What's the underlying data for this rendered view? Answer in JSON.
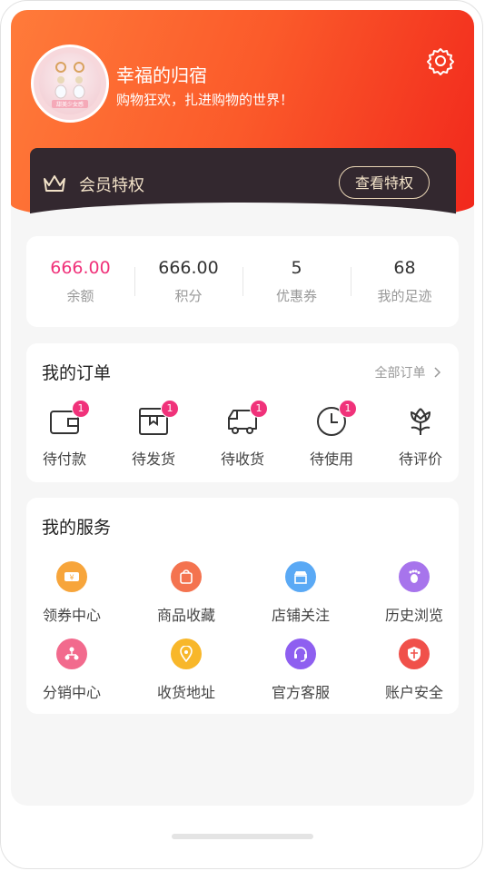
{
  "profile": {
    "username": "幸福的归宿",
    "signature": "购物狂欢，扎进购物的世界！",
    "avatar_text": "甜美少女感"
  },
  "vip": {
    "title": "会员特权",
    "button": "查看特权"
  },
  "stats": [
    {
      "value": "666.00",
      "label": "余额"
    },
    {
      "value": "666.00",
      "label": "积分"
    },
    {
      "value": "5",
      "label": "优惠券"
    },
    {
      "value": "68",
      "label": "我的足迹"
    }
  ],
  "orders": {
    "title": "我的订单",
    "all_link": "全部订单",
    "items": [
      {
        "label": "待付款",
        "badge": "1",
        "icon": "wallet-icon"
      },
      {
        "label": "待发货",
        "badge": "1",
        "icon": "box-icon"
      },
      {
        "label": "待收货",
        "badge": "1",
        "icon": "truck-icon"
      },
      {
        "label": "待使用",
        "badge": "1",
        "icon": "clock-icon"
      },
      {
        "label": "待评价",
        "badge": "",
        "icon": "flower-icon"
      }
    ]
  },
  "services": {
    "title": "我的服务",
    "items": [
      {
        "label": "领券中心",
        "icon": "coupon-icon",
        "color": "#f7a53b"
      },
      {
        "label": "商品收藏",
        "icon": "bag-icon",
        "color": "#f4734f"
      },
      {
        "label": "店铺关注",
        "icon": "store-icon",
        "color": "#5aa9f5"
      },
      {
        "label": "历史浏览",
        "icon": "footprint-icon",
        "color": "#a774ec"
      },
      {
        "label": "分销中心",
        "icon": "distribution-icon",
        "color": "#f26a8d"
      },
      {
        "label": "收货地址",
        "icon": "location-icon",
        "color": "#f8b72a"
      },
      {
        "label": "官方客服",
        "icon": "headset-icon",
        "color": "#8e5ff0"
      },
      {
        "label": "账户安全",
        "icon": "shield-icon",
        "color": "#f0504a"
      }
    ]
  },
  "colors": {
    "header_start": "#ff7b3a",
    "header_end": "#f1271c",
    "vip_bg": "#33282f",
    "vip_text": "#f2e2c8",
    "accent_pink": "#f0327a"
  }
}
